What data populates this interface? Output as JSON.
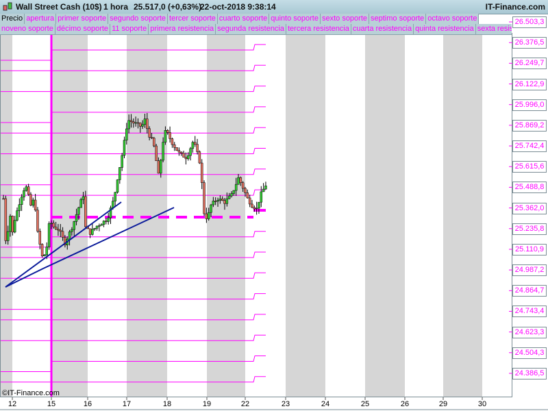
{
  "header": {
    "instrument": "Wall Street Cash (10$)",
    "timeframe": "1 hora",
    "price": "25.517,0 (+0,63%)",
    "datetime": "22-oct-2018 9:38:14",
    "brand": "IT-Finance.com"
  },
  "tabs_row1": [
    "Precio",
    "apertura",
    "primer soporte",
    "segundo soporte",
    "tercer soporte",
    "cuarto soporte",
    "quinto soporte",
    "sexto soporte",
    "septimo soporte",
    "octavo soporte"
  ],
  "tabs_row2": [
    "noveno soporte",
    "décimo soporte",
    "11 soporte",
    "primera resistencia",
    "segunda resistencia",
    "tercera resistencia",
    "cuarta resistencia",
    "quinta resistencia",
    "sexta resis"
  ],
  "copyright": "©IT-Finance.com",
  "colors": {
    "level": "#ff00ff",
    "trend": "#0a1a9a",
    "up": "#33cc33",
    "down": "#e07060"
  },
  "chart_data": {
    "type": "candlestick",
    "y_labels": [
      "26.503,3",
      "26.376,5",
      "26.249,7",
      "26.122,9",
      "25.996,0",
      "25.869,2",
      "25.742,4",
      "25.615,6",
      "25.488,8",
      "25.362,0",
      "25.235,8",
      "25.110,9",
      "24.987,2",
      "24.864,7",
      "24.743,4",
      "24.623,3",
      "24.504,3",
      "24.386,5"
    ],
    "ylim": [
      24386.5,
      26503.3
    ],
    "x_labels": [
      "12",
      "15",
      "16",
      "17",
      "18",
      "19",
      "22",
      "23",
      "24",
      "25",
      "26",
      "29",
      "30"
    ],
    "current_level": 25362.0,
    "close_path": [
      [
        0,
        25439
      ],
      [
        1.5,
        25068
      ],
      [
        2.4,
        25398
      ],
      [
        4,
        25233
      ],
      [
        5,
        25315
      ],
      [
        7.5,
        25439
      ],
      [
        9.7,
        25522
      ],
      [
        12,
        25398
      ],
      [
        13.6,
        25439
      ],
      [
        15,
        25233
      ],
      [
        17.3,
        25068
      ],
      [
        19,
        25150
      ],
      [
        20.3,
        25315
      ],
      [
        21.5,
        25274
      ],
      [
        24.2,
        25253
      ],
      [
        27,
        25171
      ],
      [
        30.3,
        25274
      ],
      [
        33.3,
        25398
      ],
      [
        35,
        25460
      ],
      [
        35.5,
        25274
      ],
      [
        38,
        25233
      ],
      [
        41,
        25274
      ],
      [
        45.5,
        25315
      ],
      [
        48.5,
        25439
      ],
      [
        50,
        25563
      ],
      [
        52.4,
        25728
      ],
      [
        54.5,
        25913
      ],
      [
        57.5,
        25893
      ],
      [
        60.6,
        25872
      ],
      [
        62,
        25913
      ],
      [
        63.6,
        25831
      ],
      [
        65.8,
        25769
      ],
      [
        68.2,
        25563
      ],
      [
        69.7,
        25769
      ],
      [
        71.2,
        25851
      ],
      [
        74.2,
        25769
      ],
      [
        77.3,
        25707
      ],
      [
        80.3,
        25686
      ],
      [
        83.3,
        25789
      ],
      [
        86.4,
        25645
      ],
      [
        87.9,
        25356
      ],
      [
        89.4,
        25315
      ],
      [
        90.9,
        25398
      ],
      [
        93.9,
        25439
      ],
      [
        97,
        25418
      ],
      [
        100,
        25460
      ],
      [
        103,
        25563
      ],
      [
        104.5,
        25522
      ],
      [
        107,
        25439
      ],
      [
        109,
        25398
      ],
      [
        111,
        25377
      ],
      [
        112.7,
        25460
      ],
      [
        115.8,
        25542
      ]
    ]
  }
}
